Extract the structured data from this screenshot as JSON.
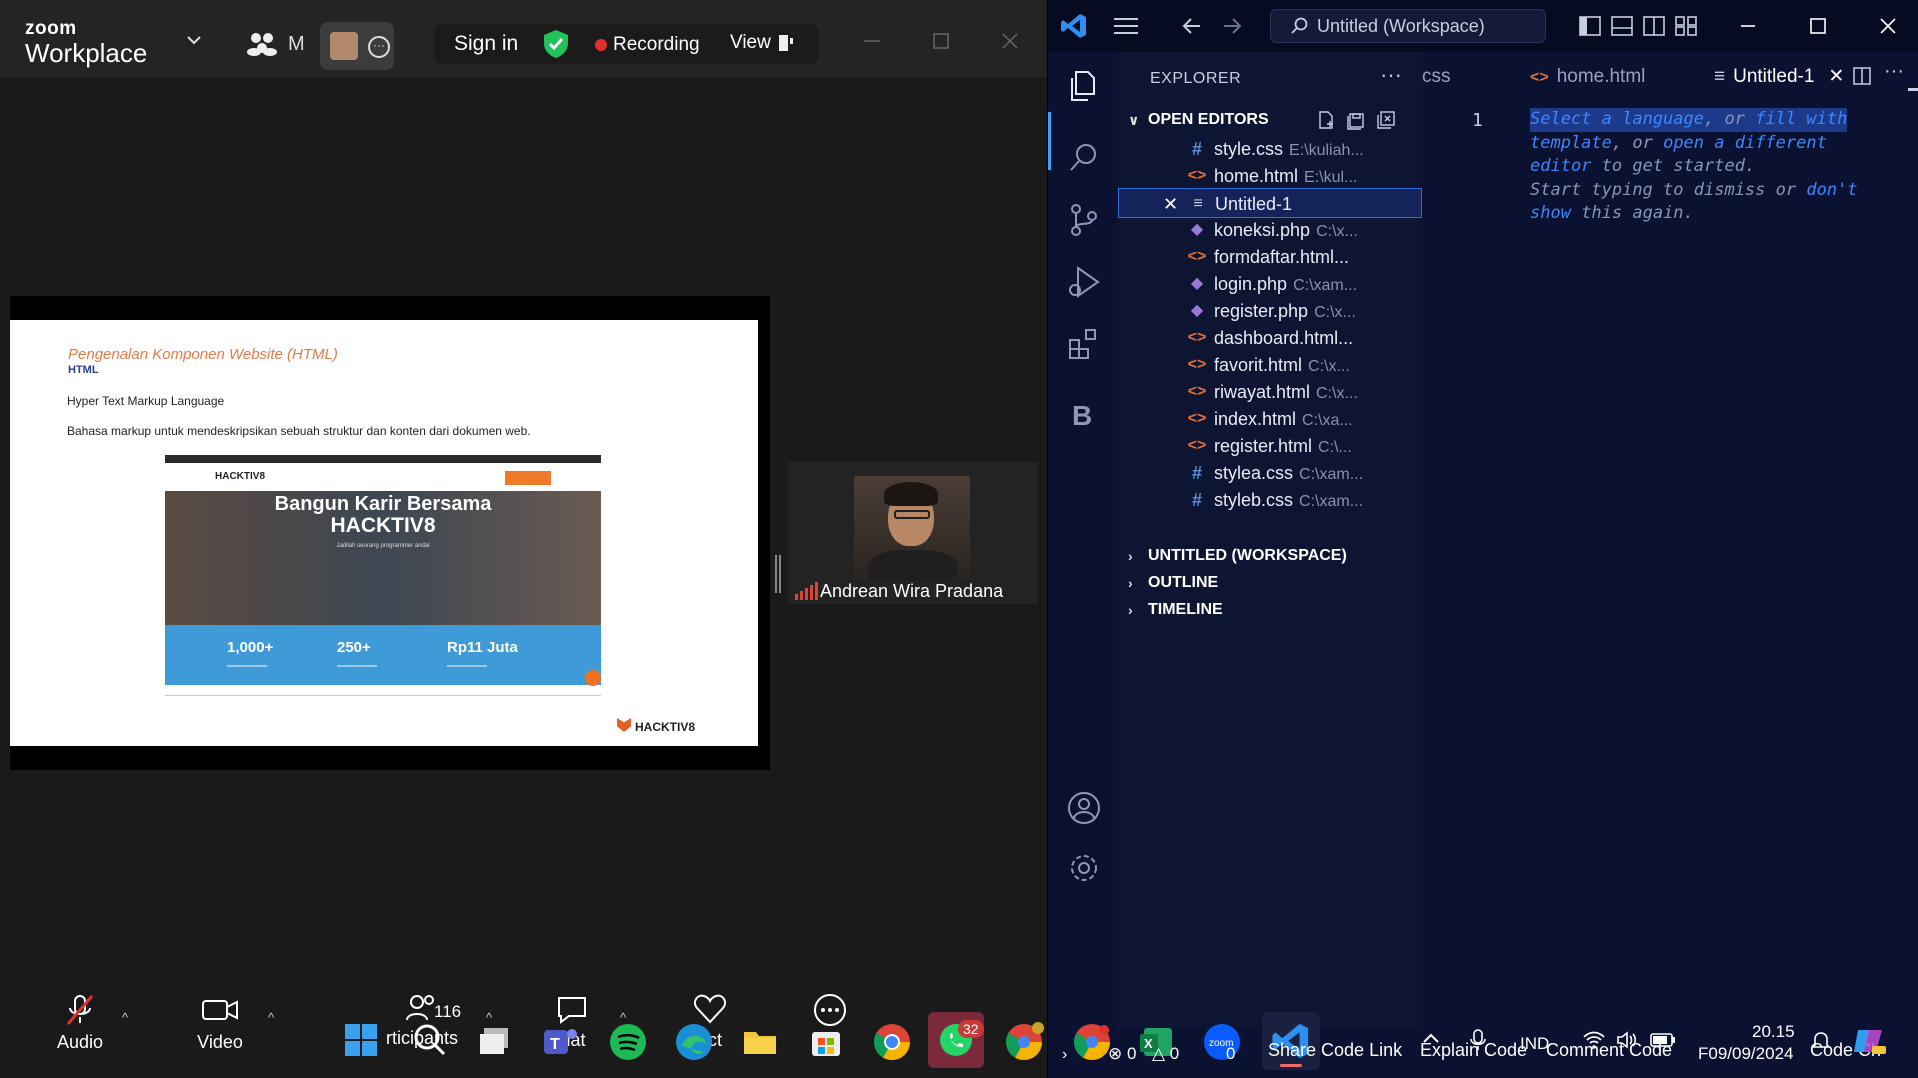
{
  "zoom": {
    "logo_small": "zoom",
    "logo_big": "Workplace",
    "user_initial": "M",
    "signin_label": "Sign in",
    "recording_label": "Recording",
    "view_label": "View",
    "slide": {
      "title": "Pengenalan Komponen Website (HTML)",
      "subtitle": "HTML",
      "line1": "Hyper Text Markup Language",
      "line2": "Bahasa markup untuk mendeskripsikan sebuah struktur dan konten dari dokumen web.",
      "shot_brand": "HACKTIV8",
      "shot_headline_1": "Bangun Karir Bersama",
      "shot_headline_2": "HACKTIV8",
      "shot_tagline": "Jadilah seorang programmer andal",
      "stats": [
        "1,000+",
        "250+",
        "Rp11 Juta"
      ],
      "footer_brand": "HACKTIV8"
    },
    "participant_name": "Andrean Wira Pradana",
    "toolbar": {
      "audio_label": "Audio",
      "video_label": "Video",
      "participants_label": "rticipants",
      "participants_count": "116",
      "chat_label": "hat",
      "react_label": "act",
      "more_label": "e"
    }
  },
  "vscode": {
    "search_label": "Untitled (Workspace)",
    "explorer_label": "EXPLORER",
    "open_editors_label": "OPEN EDITORS",
    "open_editors": [
      {
        "name": "style.css",
        "path": "E:\\kuliah...",
        "type": "css"
      },
      {
        "name": "home.html",
        "path": "E:\\kul...",
        "type": "html"
      },
      {
        "name": "Untitled-1",
        "path": "",
        "type": "txt",
        "selected": true
      },
      {
        "name": "koneksi.php",
        "path": "C:\\x...",
        "type": "php"
      },
      {
        "name": "formdaftar.html...",
        "path": "",
        "type": "html"
      },
      {
        "name": "login.php",
        "path": "C:\\xam...",
        "type": "php"
      },
      {
        "name": "register.php",
        "path": "C:\\x...",
        "type": "php"
      },
      {
        "name": "dashboard.html...",
        "path": "",
        "type": "html"
      },
      {
        "name": "favorit.html",
        "path": "C:\\x...",
        "type": "html"
      },
      {
        "name": "riwayat.html",
        "path": "C:\\x...",
        "type": "html"
      },
      {
        "name": "index.html",
        "path": "C:\\xa...",
        "type": "html"
      },
      {
        "name": "register.html",
        "path": "C:\\...",
        "type": "html"
      },
      {
        "name": "stylea.css",
        "path": "C:\\xam...",
        "type": "css"
      },
      {
        "name": "styleb.css",
        "path": "C:\\xam...",
        "type": "css"
      }
    ],
    "sections": [
      "UNTITLED (WORKSPACE)",
      "OUTLINE",
      "TIMELINE"
    ],
    "tabs": [
      {
        "label": "css",
        "active": false
      },
      {
        "label": "home.html",
        "active": false
      },
      {
        "label": "Untitled-1",
        "active": true
      }
    ],
    "activity_b": "B",
    "editor": {
      "line_number": "1",
      "hint_sel": "Select a language",
      "hint_or1": ", or ",
      "hint_fill": "fill with",
      "hint_template": "template",
      "hint_or2": ", or ",
      "hint_open": "open a different",
      "hint_editor": "editor",
      "hint_rest1": " to get started.",
      "hint_start": "Start typing to dismiss or ",
      "hint_dont": "don't",
      "hint_show": "show",
      "hint_rest2": " this again."
    }
  },
  "taskbar": {
    "whatsapp_badge": "32",
    "errors_count": "0",
    "warnings_count": "0",
    "ports_count": "0",
    "share_code_link": "Share Code Link",
    "explain_code": "Explain Code",
    "comment_code": "Comment Code",
    "code_ch": "Code Ch",
    "lang": "IND",
    "time": "20.15",
    "date": "09/09/2024",
    "taskbar_day": "F"
  },
  "colors": {
    "zoom_bg": "#1a1a1a",
    "vscode_bg": "#0b1130",
    "accent_blue": "#3d86ff",
    "recording_red": "#e0312b",
    "hacktiv_orange": "#f07020"
  }
}
